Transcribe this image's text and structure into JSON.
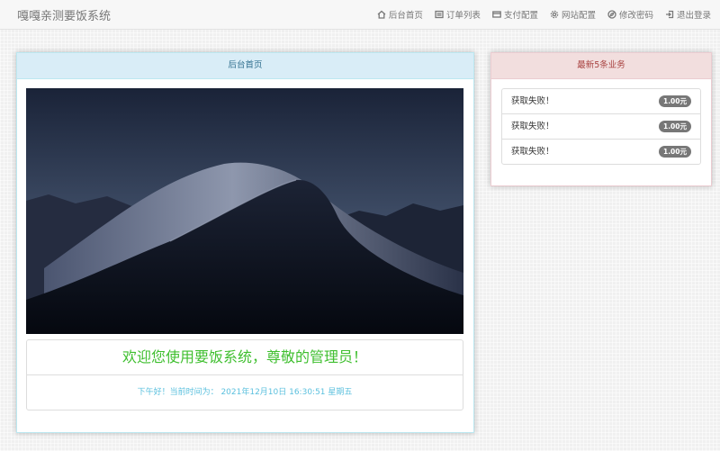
{
  "brand": "嘎嘎亲测要饭系统",
  "nav": [
    {
      "icon": "home-icon",
      "label": "后台首页"
    },
    {
      "icon": "list-icon",
      "label": "订单列表"
    },
    {
      "icon": "credit-card-icon",
      "label": "支付配置"
    },
    {
      "icon": "gear-icon",
      "label": "网站配置"
    },
    {
      "icon": "compass-icon",
      "label": "修改密码"
    },
    {
      "icon": "logout-icon",
      "label": "退出登录"
    }
  ],
  "main_panel": {
    "title": "后台首页",
    "welcome": "欢迎您使用要饭系统，尊敬的管理员！",
    "time_line": "下午好！当前时间为： 2021年12月10日 16:30:51   星期五"
  },
  "side_panel": {
    "title": "最新5条业务",
    "items": [
      {
        "text": "获取失败！",
        "amount": "1.00元"
      },
      {
        "text": "获取失败！",
        "amount": "1.00元"
      },
      {
        "text": "获取失败！",
        "amount": "1.00元"
      }
    ]
  },
  "colors": {
    "info_bg": "#d9edf7",
    "info_text": "#31708f",
    "danger_bg": "#f2dede",
    "danger_text": "#a94442",
    "welcome_green": "#3fbf2f",
    "time_blue": "#5bc0de",
    "badge": "#777777"
  }
}
